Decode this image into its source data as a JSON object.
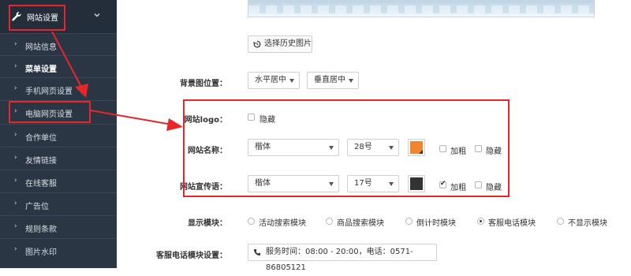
{
  "sidebar": {
    "header": {
      "label": "网站设置",
      "icon": "wrench-icon"
    },
    "items": [
      {
        "label": "网站信息",
        "bold": false
      },
      {
        "label": "菜单设置",
        "bold": true
      },
      {
        "label": "手机网页设置",
        "bold": false
      },
      {
        "label": "电脑网页设置",
        "bold": false
      },
      {
        "label": "合作单位",
        "bold": false
      },
      {
        "label": "友情链接",
        "bold": false
      },
      {
        "label": "在线客服",
        "bold": false
      },
      {
        "label": "广告位",
        "bold": false
      },
      {
        "label": "规则条款",
        "bold": false
      },
      {
        "label": "图片水印",
        "bold": false
      }
    ],
    "colors": {
      "background": "#2b3644",
      "header_background": "#242e3b"
    }
  },
  "main": {
    "history_button": "选择历史图片",
    "bg_position": {
      "label": "背景图位置：",
      "horizontal": "水平居中",
      "vertical": "垂直居中"
    },
    "logo": {
      "label": "网站logo：",
      "hide_label": "隐藏",
      "hide_checked": false
    },
    "site_name": {
      "label": "网站名称：",
      "font": "楷体",
      "size": "28号",
      "color": "#f0852d",
      "bold_label": "加粗",
      "bold_checked": false,
      "hide_label": "隐藏",
      "hide_checked": false
    },
    "site_slogan": {
      "label": "网站宣传语：",
      "font": "楷体",
      "size": "17号",
      "color": "#333333",
      "bold_label": "加粗",
      "bold_checked": true,
      "hide_label": "隐藏",
      "hide_checked": false
    },
    "display_module": {
      "label": "显示模块：",
      "options": [
        "活动搜索模块",
        "商品搜索模块",
        "倒计时模块",
        "客服电话模块",
        "不显示模块"
      ],
      "selected_index": 3
    },
    "service_phone": {
      "label": "客服电话模块设置：",
      "value": "服务时间：08:00 - 20:00，电话：0571-86805121"
    }
  },
  "annotation_color": "#e8262a"
}
